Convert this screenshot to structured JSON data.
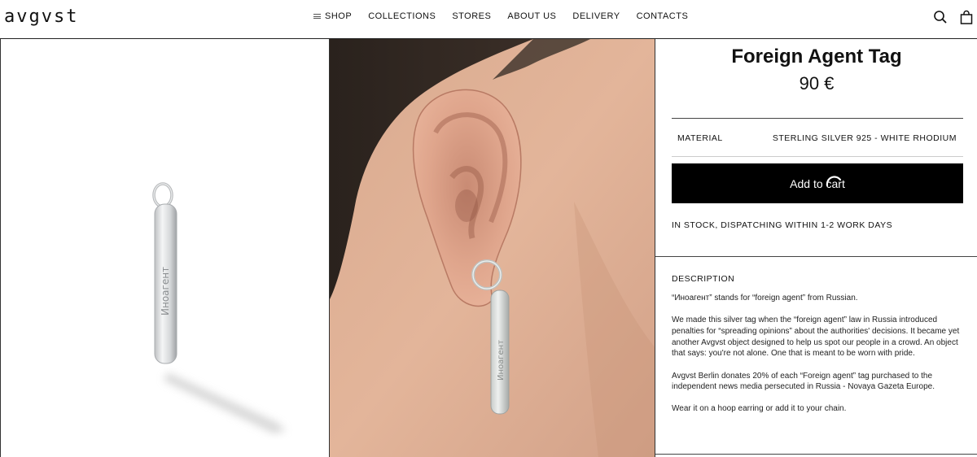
{
  "header": {
    "logo": "avgvst",
    "nav": [
      "SHOP",
      "COLLECTIONS",
      "STORES",
      "ABOUT US",
      "DELIVERY",
      "CONTACTS"
    ]
  },
  "product": {
    "title": "Foreign Agent Tag",
    "price": "90 €",
    "material_label": "MATERIAL",
    "material_value": "STERLING SILVER 925 - WHITE RHODIUM",
    "add_to_cart": "Add to cart",
    "stock": "IN STOCK, DISPATCHING WITHIN 1-2 WORK DAYS",
    "description_heading": "DESCRIPTION",
    "description": [
      "“Иноагент” stands for “foreign agent” from Russian.",
      "We made this silver tag when the “foreign agent” law in Russia introduced penalties for “spreading opinions” about the authorities' decisions. It became yet another Avgvst object designed to help us spot our people in a crowd. An object that says: you're not alone. One that is meant to be worn with pride.",
      "Avgvst Berlin donates 20% of each “Foreign agent” tag purchased to the independent news media persecuted in Russia - Novaya Gazeta Europe.",
      "Wear it on a hoop earring or add it to your chain."
    ],
    "engraving": "Иноагент"
  },
  "icons": {
    "menu": "menu-icon",
    "search": "search-icon",
    "bag": "bag-icon",
    "loading": "loading-spinner-icon"
  }
}
